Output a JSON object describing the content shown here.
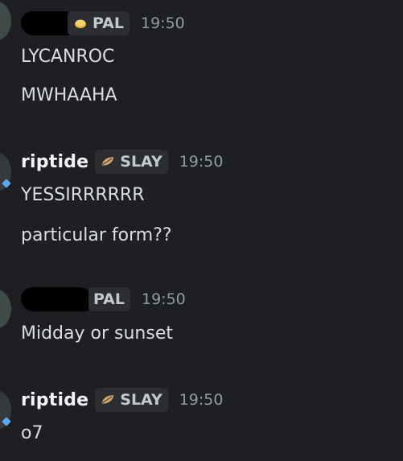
{
  "messages": [
    {
      "author": "",
      "tag": "PAL",
      "tag_icon": "gold-coin-icon",
      "time": "19:50",
      "lines": [
        "LYCANROC",
        "MWHAAHA"
      ]
    },
    {
      "author": "riptide",
      "tag": "SLAY",
      "tag_icon": "leaf-icon",
      "time": "19:50",
      "lines": [
        "YESSIRRRRRR",
        "particular form??"
      ]
    },
    {
      "author": "",
      "tag": "PAL",
      "tag_icon": "",
      "time": "19:50",
      "lines": [
        "Midday or sunset"
      ]
    },
    {
      "author": "riptide",
      "tag": "SLAY",
      "tag_icon": "leaf-icon",
      "time": "19:50",
      "lines": [
        "o7"
      ]
    }
  ]
}
